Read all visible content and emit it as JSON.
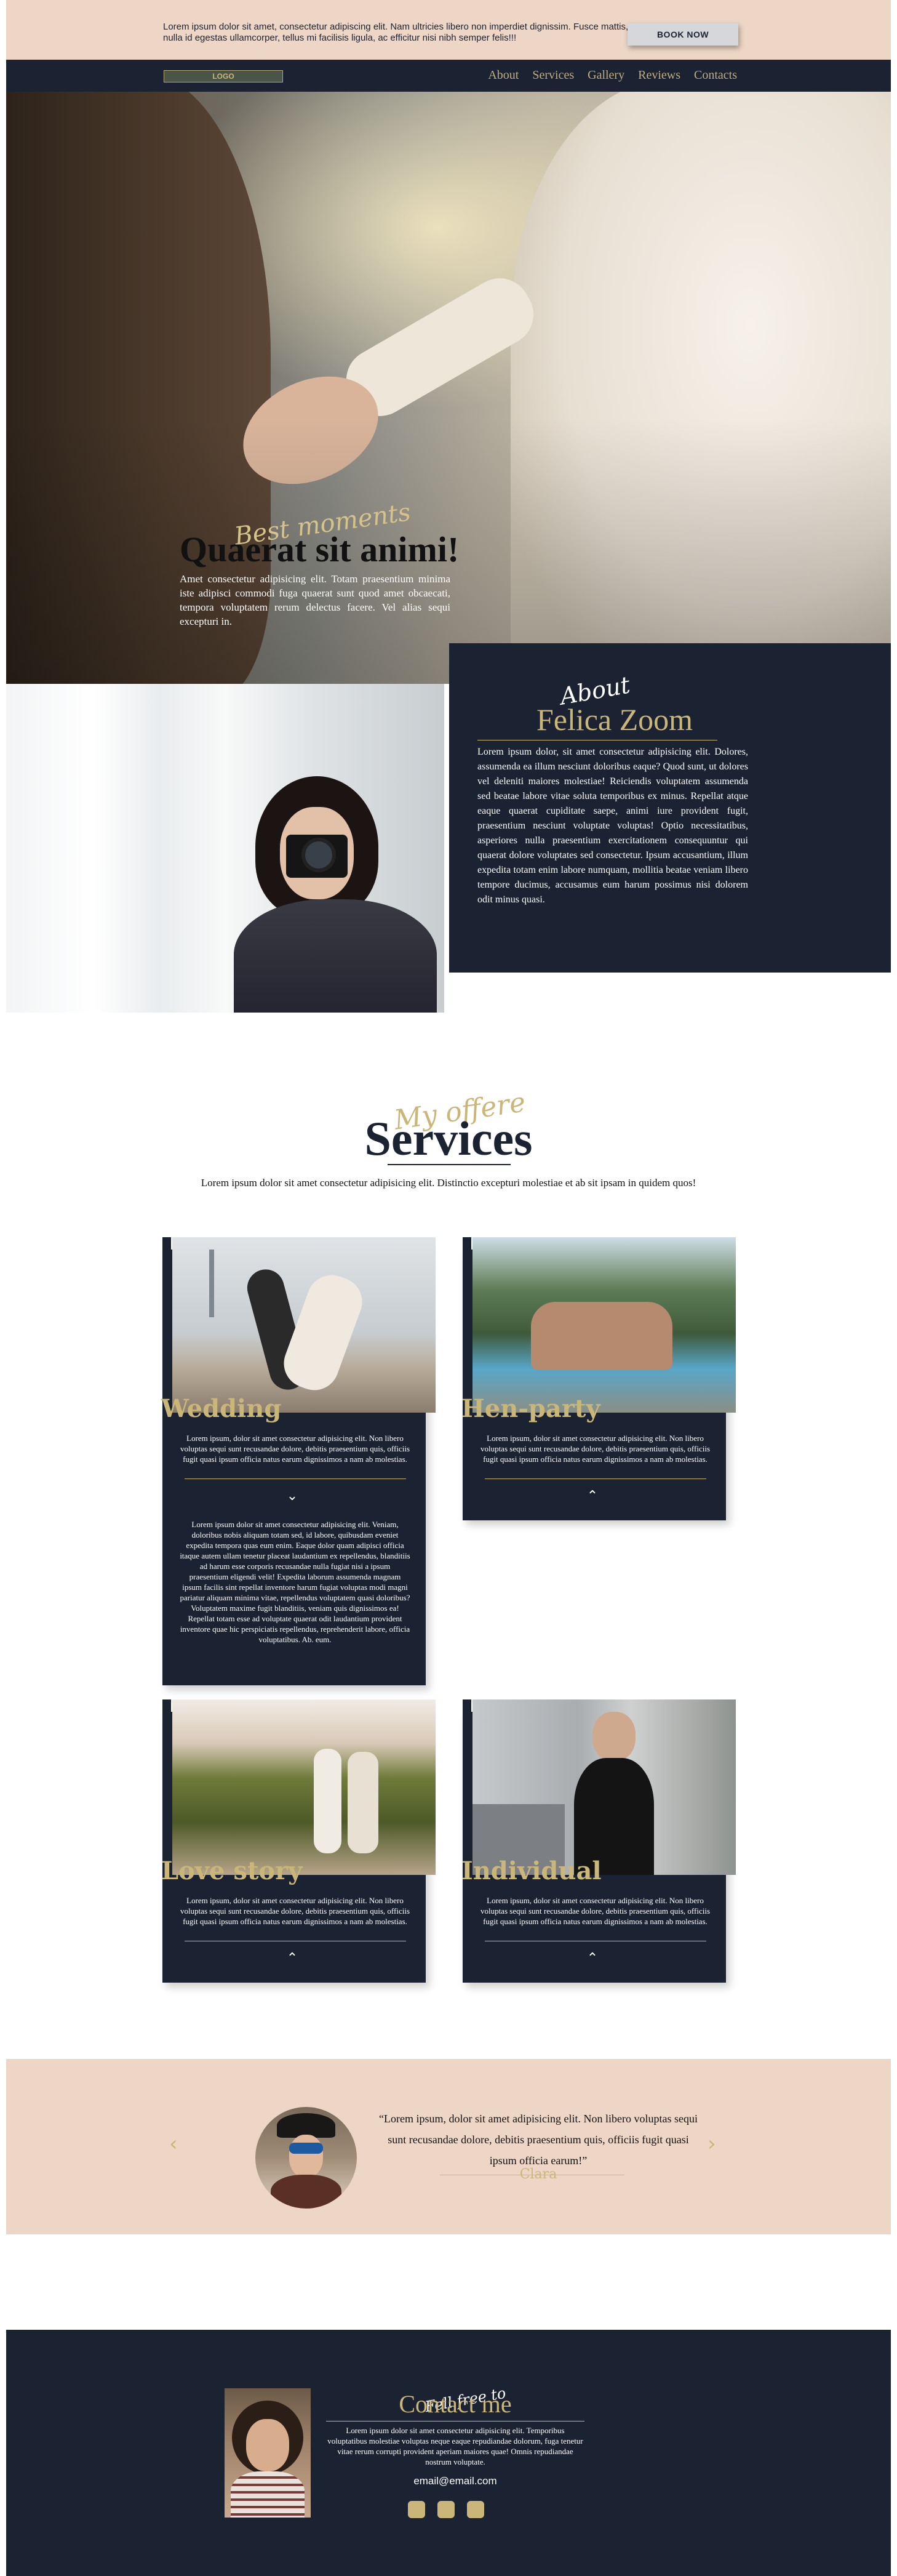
{
  "topbar": {
    "text": "Lorem ipsum dolor sit amet, consectetur adipiscing elit. Nam ultricies libero non imperdiet dignissim. Fusce mattis, nulla id egestas ullamcorper, tellus mi facilisis ligula, ac efficitur nisi nibh semper felis!!!",
    "button_label": "BOOK NOW"
  },
  "nav": {
    "logo": "LOGO",
    "items": [
      "About",
      "Services",
      "Gallery",
      "Reviews",
      "Contacts"
    ]
  },
  "hero": {
    "script": "Best moments",
    "title": "Quaerat sit animi!",
    "text": "Amet consectetur adipisicing elit. Totam praesentium minima iste adipisci commodi fuga quaerat sunt quod amet obcaecati, tempora voluptatem rerum delectus facere. Vel alias sequi excepturi in."
  },
  "about": {
    "script": "About",
    "title": "Felica Zoom",
    "text": "Lorem ipsum dolor, sit amet consectetur adipisicing elit. Dolores, assumenda ea illum nesciunt doloribus eaque? Quod sunt, ut dolores vel deleniti maiores molestiae! Reiciendis voluptatem assumenda sed beatae labore vitae soluta temporibus ex minus. Repellat atque eaque quaerat cupiditate saepe, animi iure provident fugit, praesentium nesciunt voluptate voluptas! Optio necessitatibus, asperiores nulla praesentium exercitationem consequuntur qui quaerat dolore voluptates sed consectetur. Ipsum accusantium, illum expedita totam enim labore numquam, mollitia beatae veniam libero tempore ducimus, accusamus eum harum possimus nisi dolorem odit minus quasi."
  },
  "services": {
    "script": "My offere",
    "title": "Services",
    "subtitle": "Lorem ipsum dolor sit amet consectetur adipisicing elit. Distinctio excepturi molestiae et ab sit ipsam in quidem quos!",
    "cards": [
      {
        "title": "Wedding",
        "text": "Lorem ipsum, dolor sit amet consectetur adipisicing elit. Non libero voluptas sequi sunt recusandae dolore, debitis praesentium quis, officiis fugit quasi ipsum officia natus earum dignissimos a nam ab molestias.",
        "chevron": "⌄",
        "extra": "Lorem ipsum dolor sit amet consectetur adipisicing elit. Veniam, doloribus nobis aliquam totam sed, id labore, quibusdam eveniet expedita tempora quas eum enim. Eaque dolor quam adipisci officia itaque autem ullam tenetur placeat laudantium ex repellendus, blanditiis ad harum esse corporis recusandae nulla fugiat nisi a ipsum praesentium eligendi velit! Expedita laborum assumenda magnam ipsum facilis sint repellat inventore harum fugiat voluptas modi magni pariatur aliquam minima vitae, repellendus voluptatem quasi doloribus? Voluptatem maxime fugit blanditiis, veniam quis dignissimos ea! Repellat totam esse ad voluptate quaerat odit laudantium provident inventore quae hic perspiciatis repellendus, reprehenderit labore, officia voluptatibus. Ab. eum."
      },
      {
        "title": "Hen-party",
        "text": "Lorem ipsum, dolor sit amet consectetur adipisicing elit. Non libero voluptas sequi sunt recusandae dolore, debitis praesentium quis, officiis fugit quasi ipsum officia natus earum dignissimos a nam ab molestias.",
        "chevron": "⌃"
      },
      {
        "title": "Love story",
        "text": "Lorem ipsum, dolor sit amet consectetur adipisicing elit. Non libero voluptas sequi sunt recusandae dolore, debitis praesentium quis, officiis fugit quasi ipsum officia natus earum dignissimos a nam ab molestias.",
        "chevron": "⌃"
      },
      {
        "title": "Individual",
        "text": "Lorem ipsum, dolor sit amet consectetur adipisicing elit. Non libero voluptas sequi sunt recusandae dolore, debitis praesentium quis, officiis fugit quasi ipsum officia natus earum dignissimos a nam ab molestias.",
        "chevron": "⌃"
      }
    ]
  },
  "testimonial": {
    "prev": "‹",
    "next": "›",
    "quote": "“Lorem ipsum, dolor sit amet  adipisicing elit. Non libero voluptas sequi sunt recusandae dolore, debitis praesentium quis, officiis fugit quasi ipsum officia  earum!”",
    "name": "Clara"
  },
  "contact": {
    "script": "Fell free to",
    "title": "Contact me",
    "text": "Lorem ipsum dolor sit amet consectetur adipisicing elit. Temporibus voluptatibus molestiae voluptas neque eaque repudiandae dolorum, fuga tenetur vitae rerum corrupti provident aperiam maiores quae! Omnis repudiandae nostrum voluptate.",
    "email": "email@email.com"
  },
  "colors": {
    "navy": "#1b2231",
    "gold": "#c9b678",
    "peach": "#eed6c6"
  },
  "icons": [
    "prev-arrow-icon",
    "next-arrow-icon",
    "chevron-down-icon",
    "chevron-up-icon",
    "social-icon"
  ]
}
